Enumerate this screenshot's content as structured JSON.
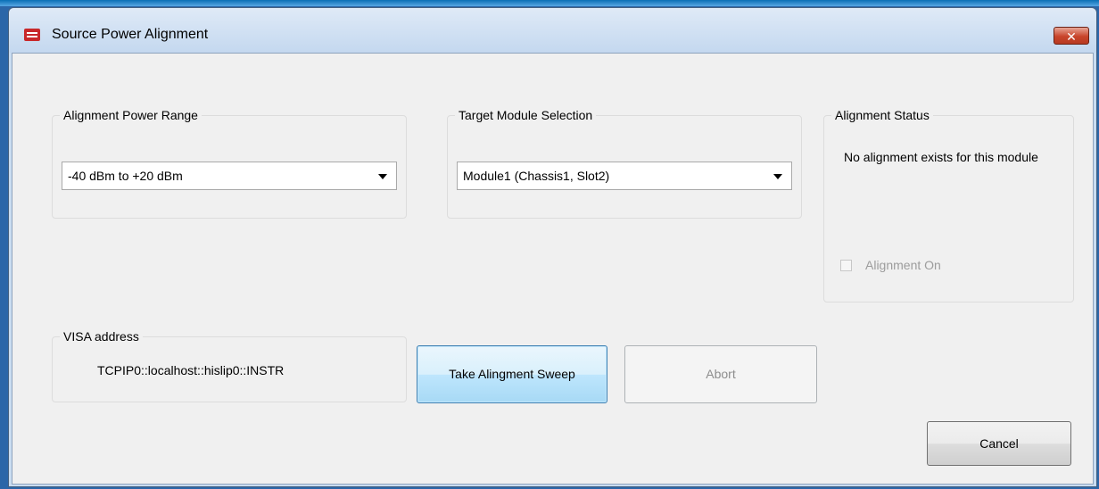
{
  "window": {
    "title": "Source Power Alignment",
    "close_label": "✕",
    "icon": "app-logo-icon"
  },
  "power_range": {
    "label": "Alignment Power Range",
    "selected": "-40 dBm to +20 dBm"
  },
  "target_module": {
    "label": "Target Module Selection",
    "selected": "Module1 (Chassis1, Slot2)"
  },
  "status": {
    "label": "Alignment Status",
    "message": "No alignment exists for this module",
    "alignment_on_label": "Alignment On",
    "alignment_on_checked": false,
    "alignment_on_enabled": false
  },
  "visa": {
    "label": "VISA address",
    "value": "TCPIP0::localhost::hislip0::INSTR"
  },
  "buttons": {
    "take_sweep": "Take Alingment Sweep",
    "abort": "Abort",
    "cancel": "Cancel"
  },
  "colors": {
    "titlebar": "#c9dcf1",
    "close_button": "#c8452b",
    "primary_button_border": "#3c7fb1"
  }
}
